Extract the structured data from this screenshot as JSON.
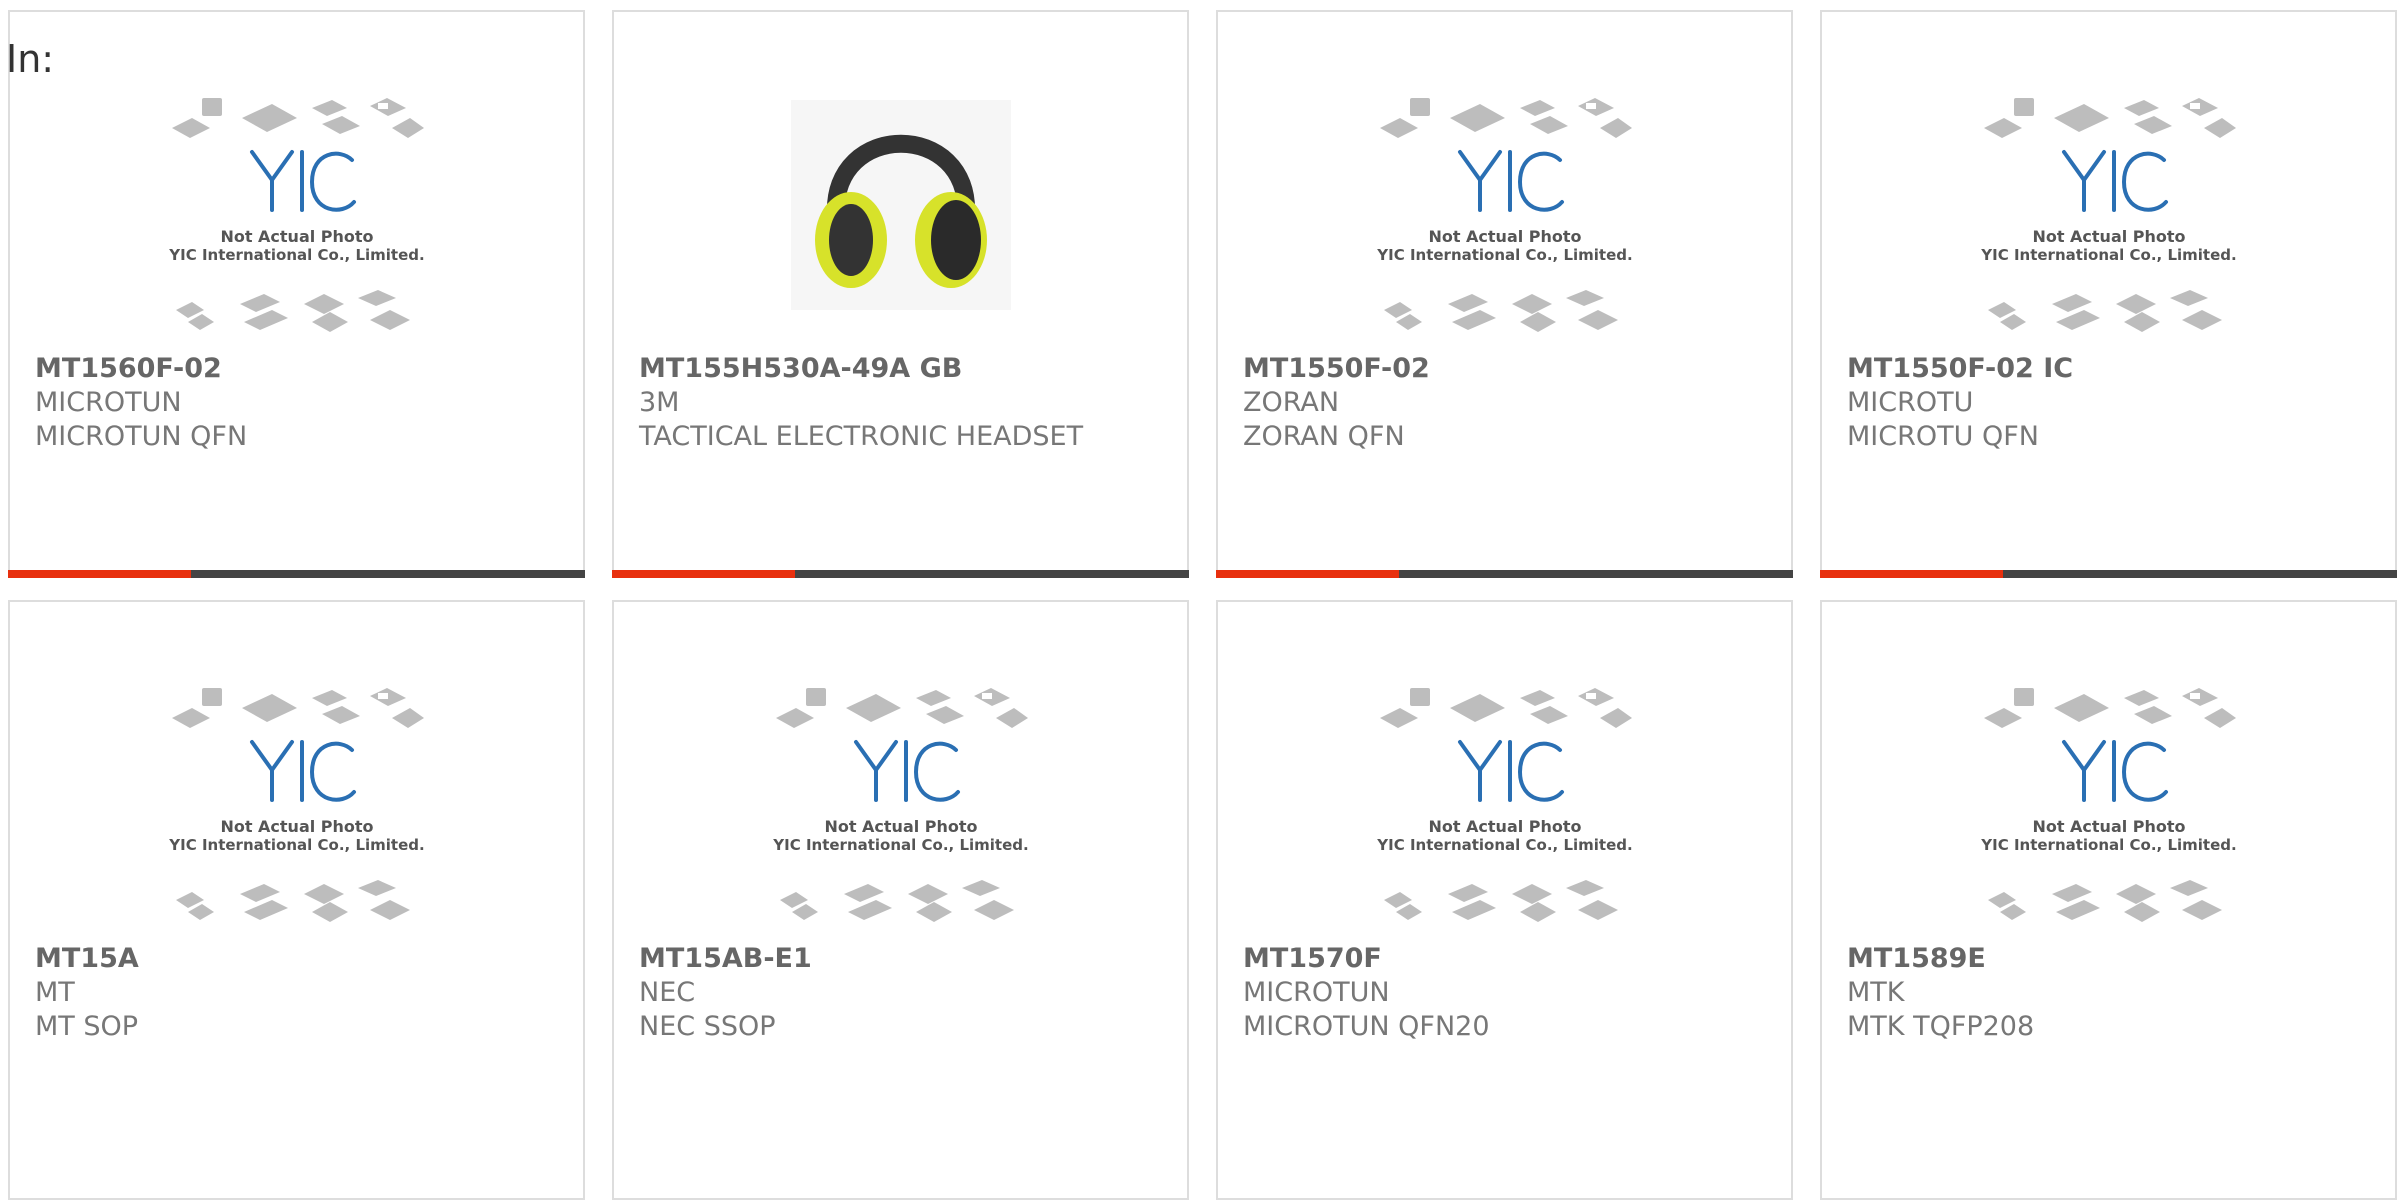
{
  "page": {
    "label": "In:"
  },
  "colors": {
    "accent": "#e8300e",
    "bar": "#444444",
    "border": "#dddddd"
  },
  "placeholder": {
    "line1": "Not Actual Photo",
    "line2": "YIC International Co., Limited.",
    "logo": "YIC"
  },
  "products": [
    {
      "part": "MT1560F-02",
      "brand": "MICROTUN",
      "desc": "MICROTUN QFN",
      "image": "placeholder"
    },
    {
      "part": "MT155H530A-49A GB",
      "brand": "3M",
      "desc": "TACTICAL ELECTRONIC HEADSET",
      "image": "headset-photo"
    },
    {
      "part": "MT1550F-02",
      "brand": "ZORAN",
      "desc": "ZORAN QFN",
      "image": "placeholder"
    },
    {
      "part": "MT1550F-02 IC",
      "brand": "MICROTU",
      "desc": "MICROTU QFN",
      "image": "placeholder"
    },
    {
      "part": "MT15A",
      "brand": "MT",
      "desc": "MT SOP",
      "image": "placeholder"
    },
    {
      "part": "MT15AB-E1",
      "brand": "NEC",
      "desc": "NEC SSOP",
      "image": "placeholder"
    },
    {
      "part": "MT1570F",
      "brand": "MICROTUN",
      "desc": "MICROTUN QFN20",
      "image": "placeholder"
    },
    {
      "part": "MT1589E",
      "brand": "MTK",
      "desc": "MTK TQFP208",
      "image": "placeholder"
    }
  ]
}
